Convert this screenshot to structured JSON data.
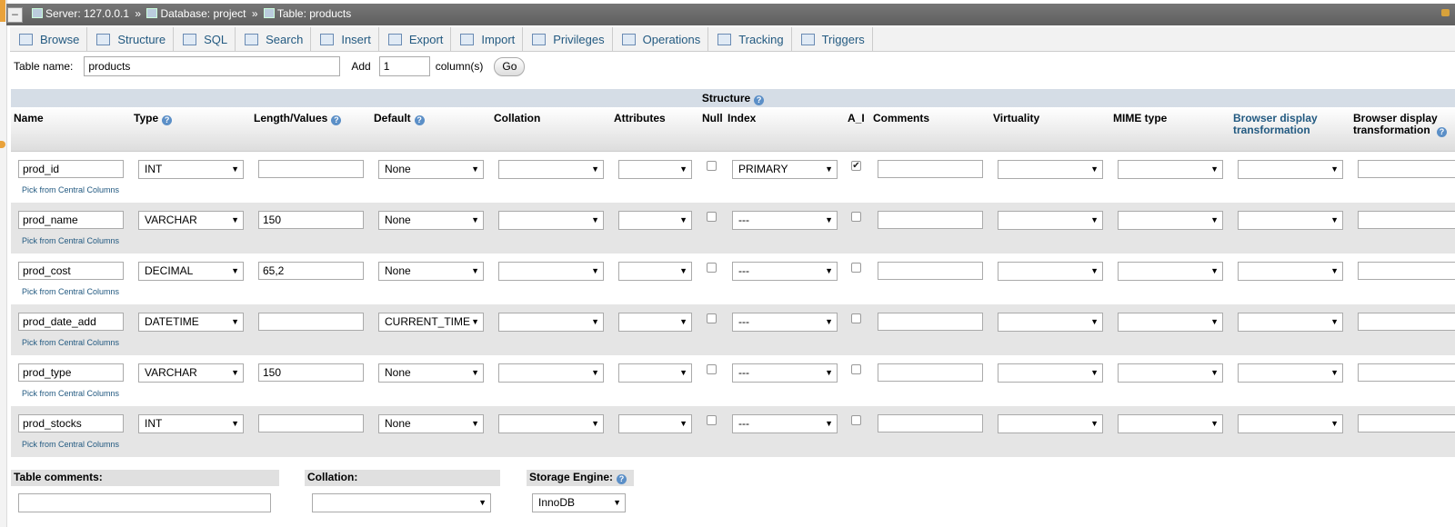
{
  "breadcrumb": {
    "server": "Server: 127.0.0.1",
    "database": "Database: project",
    "table": "Table: products",
    "sep": "»"
  },
  "tabs": [
    {
      "label": "Browse",
      "icon": "browse-icon"
    },
    {
      "label": "Structure",
      "icon": "structure-icon"
    },
    {
      "label": "SQL",
      "icon": "sql-icon"
    },
    {
      "label": "Search",
      "icon": "search-icon"
    },
    {
      "label": "Insert",
      "icon": "insert-icon"
    },
    {
      "label": "Export",
      "icon": "export-icon"
    },
    {
      "label": "Import",
      "icon": "import-icon"
    },
    {
      "label": "Privileges",
      "icon": "privileges-icon"
    },
    {
      "label": "Operations",
      "icon": "wrench-icon"
    },
    {
      "label": "Tracking",
      "icon": "eye-icon"
    },
    {
      "label": "Triggers",
      "icon": "triggers-icon"
    }
  ],
  "table_name": {
    "label": "Table name:",
    "value": "products",
    "add_label": "Add",
    "add_value": "1",
    "columns_label": "column(s)",
    "go": "Go"
  },
  "structure_title": "Structure",
  "headers": {
    "name": "Name",
    "type": "Type",
    "length": "Length/Values",
    "default": "Default",
    "collation": "Collation",
    "attributes": "Attributes",
    "null": "Null",
    "index": "Index",
    "ai": "A_I",
    "comments": "Comments",
    "virtuality": "Virtuality",
    "mime": "MIME type",
    "bdt": "Browser display transformation",
    "bdt2": "Browser display transformation"
  },
  "pick_label": "Pick from Central Columns",
  "rows": [
    {
      "name": "prod_id",
      "type": "INT",
      "length": "",
      "default": "None",
      "index": "PRIMARY",
      "ai": true
    },
    {
      "name": "prod_name",
      "type": "VARCHAR",
      "length": "150",
      "default": "None",
      "index": "---",
      "ai": false
    },
    {
      "name": "prod_cost",
      "type": "DECIMAL",
      "length": "65,2",
      "default": "None",
      "index": "---",
      "ai": false
    },
    {
      "name": "prod_date_add",
      "type": "DATETIME",
      "length": "",
      "default": "CURRENT_TIME",
      "index": "---",
      "ai": false
    },
    {
      "name": "prod_type",
      "type": "VARCHAR",
      "length": "150",
      "default": "None",
      "index": "---",
      "ai": false
    },
    {
      "name": "prod_stocks",
      "type": "INT",
      "length": "",
      "default": "None",
      "index": "---",
      "ai": false
    }
  ],
  "footer": {
    "table_comments": "Table comments:",
    "collation": "Collation:",
    "storage_engine": "Storage Engine:",
    "engine_value": "InnoDB"
  }
}
